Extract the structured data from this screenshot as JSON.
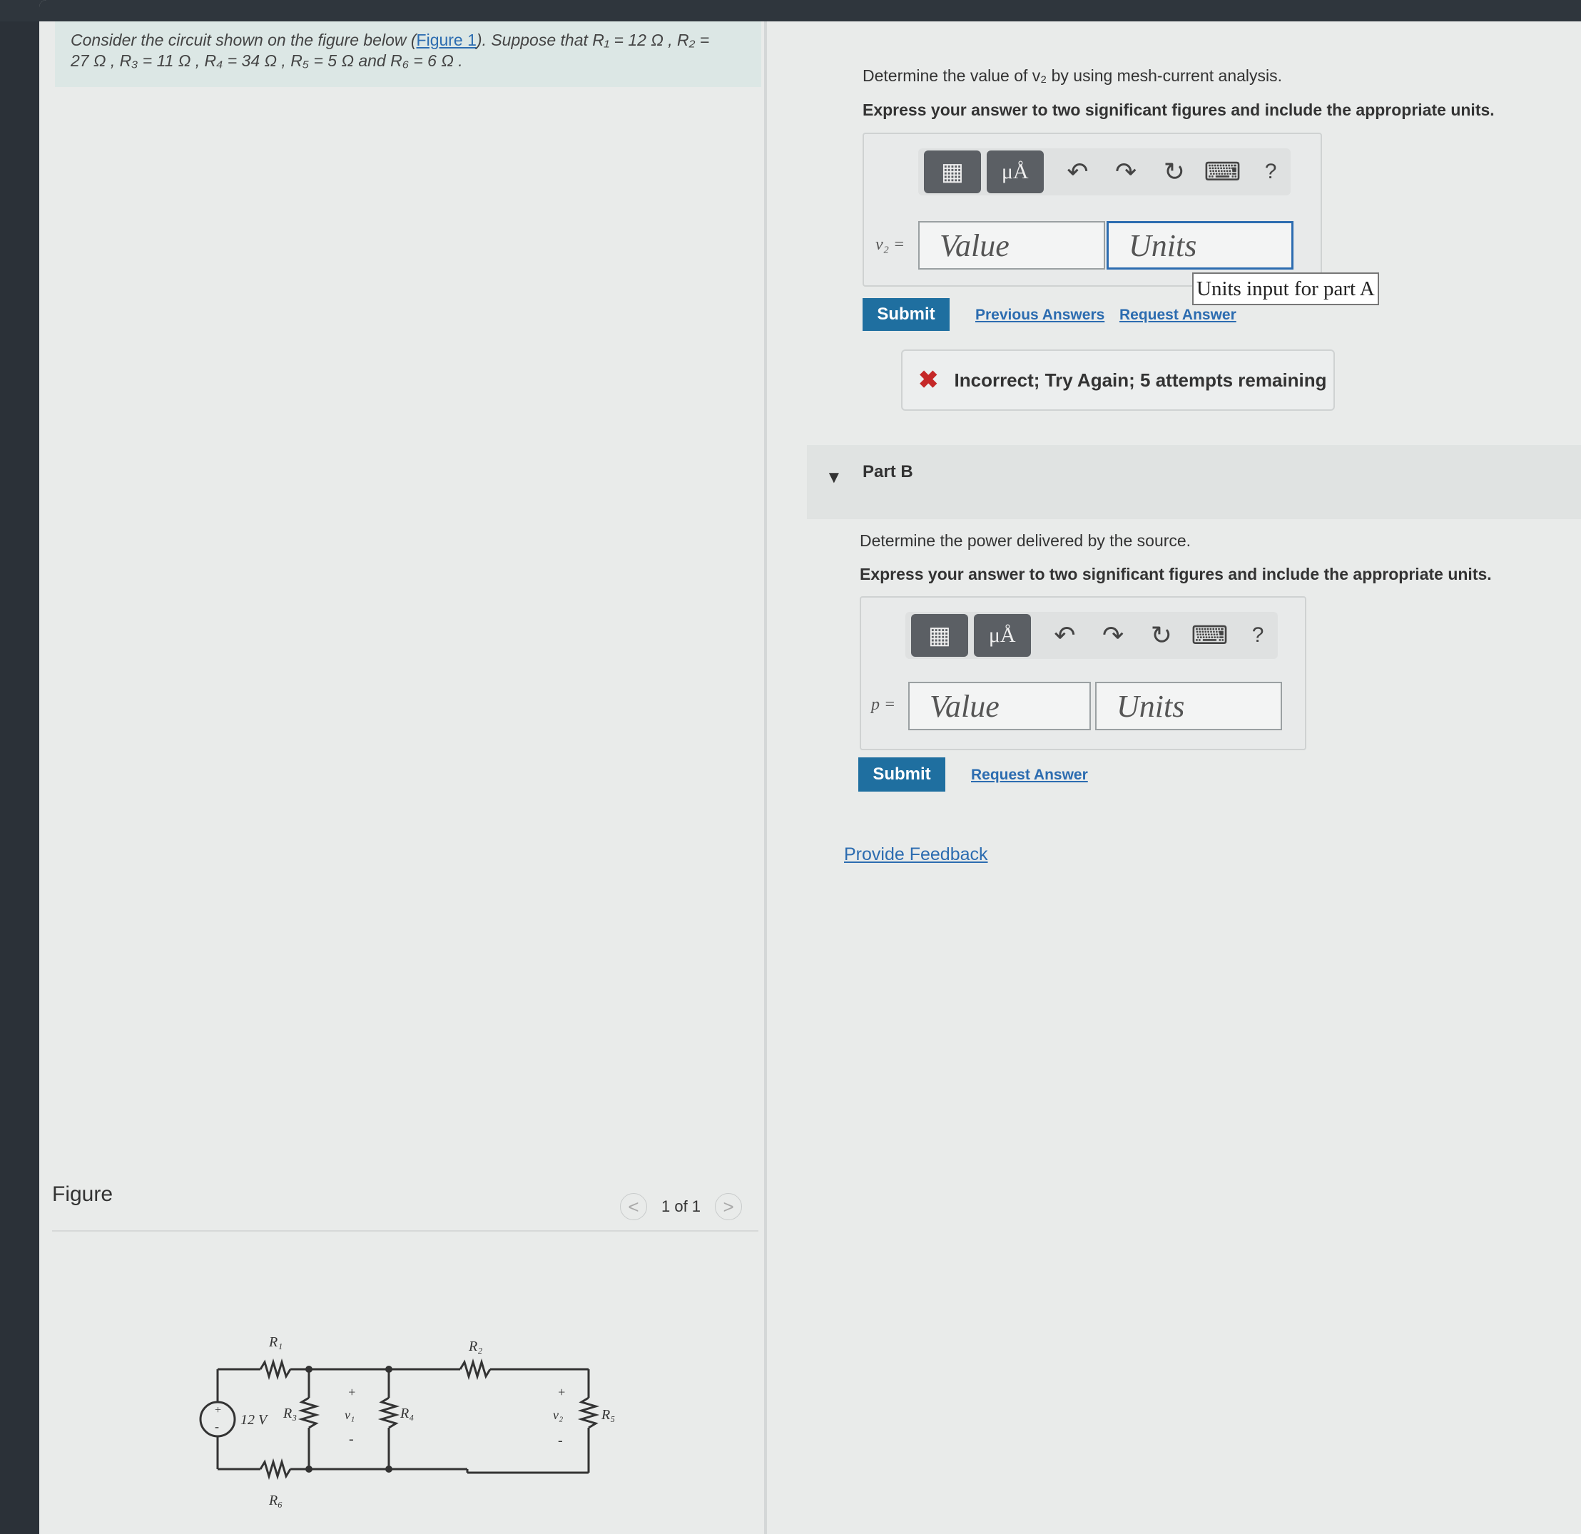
{
  "problem": {
    "intro_prefix": "Consider the circuit shown on the figure below (",
    "figure_link": "Figure 1",
    "intro_suffix": "). Suppose that R₁ = 12 Ω , R₂ =",
    "intro_line2": "27 Ω , R₃ = 11 Ω , R₄ = 34 Ω , R₅ = 5 Ω and R₆ = 6 Ω ."
  },
  "figure": {
    "label": "Figure",
    "pager": "1 of 1",
    "prev": "<",
    "next": ">",
    "circuit_labels": {
      "r1": "R₁",
      "r2": "R₂",
      "r3": "R₃",
      "r4": "R₄",
      "r5": "R₅",
      "r6": "R₆",
      "source": "12 V",
      "v1": "v₁",
      "v2": "v₂",
      "plus": "+",
      "minus": "-"
    }
  },
  "part_a": {
    "question": "Determine the value of v₂ by using mesh-current analysis.",
    "instruction": "Express your answer to two significant figures and include the appropriate units.",
    "variable": "v₂ =",
    "value_placeholder": "Value",
    "units_placeholder": "Units",
    "tooltip": "Units input for part A",
    "submit": "Submit",
    "previous_answers": "Previous Answers",
    "request_answer": "Request Answer",
    "feedback_mark": "✖",
    "feedback": "Incorrect; Try Again; 5 attempts remaining"
  },
  "part_b": {
    "caret": "▼",
    "title": "Part B",
    "question": "Determine the power delivered by the source.",
    "instruction": "Express your answer to two significant figures and include the appropriate units.",
    "variable": "p =",
    "value_placeholder": "Value",
    "units_placeholder": "Units",
    "submit": "Submit",
    "request_answer": "Request Answer"
  },
  "toolbar": {
    "units_btn": "μÅ",
    "undo": "↶",
    "redo": "↷",
    "reset": "↻",
    "keyboard": "⌨",
    "help": "?"
  },
  "provide_feedback": "Provide Feedback",
  "colors": {
    "accent": "#1f6fa0",
    "link": "#2c6cb0",
    "error": "#c52828",
    "intro_bg": "#dce7e5"
  }
}
